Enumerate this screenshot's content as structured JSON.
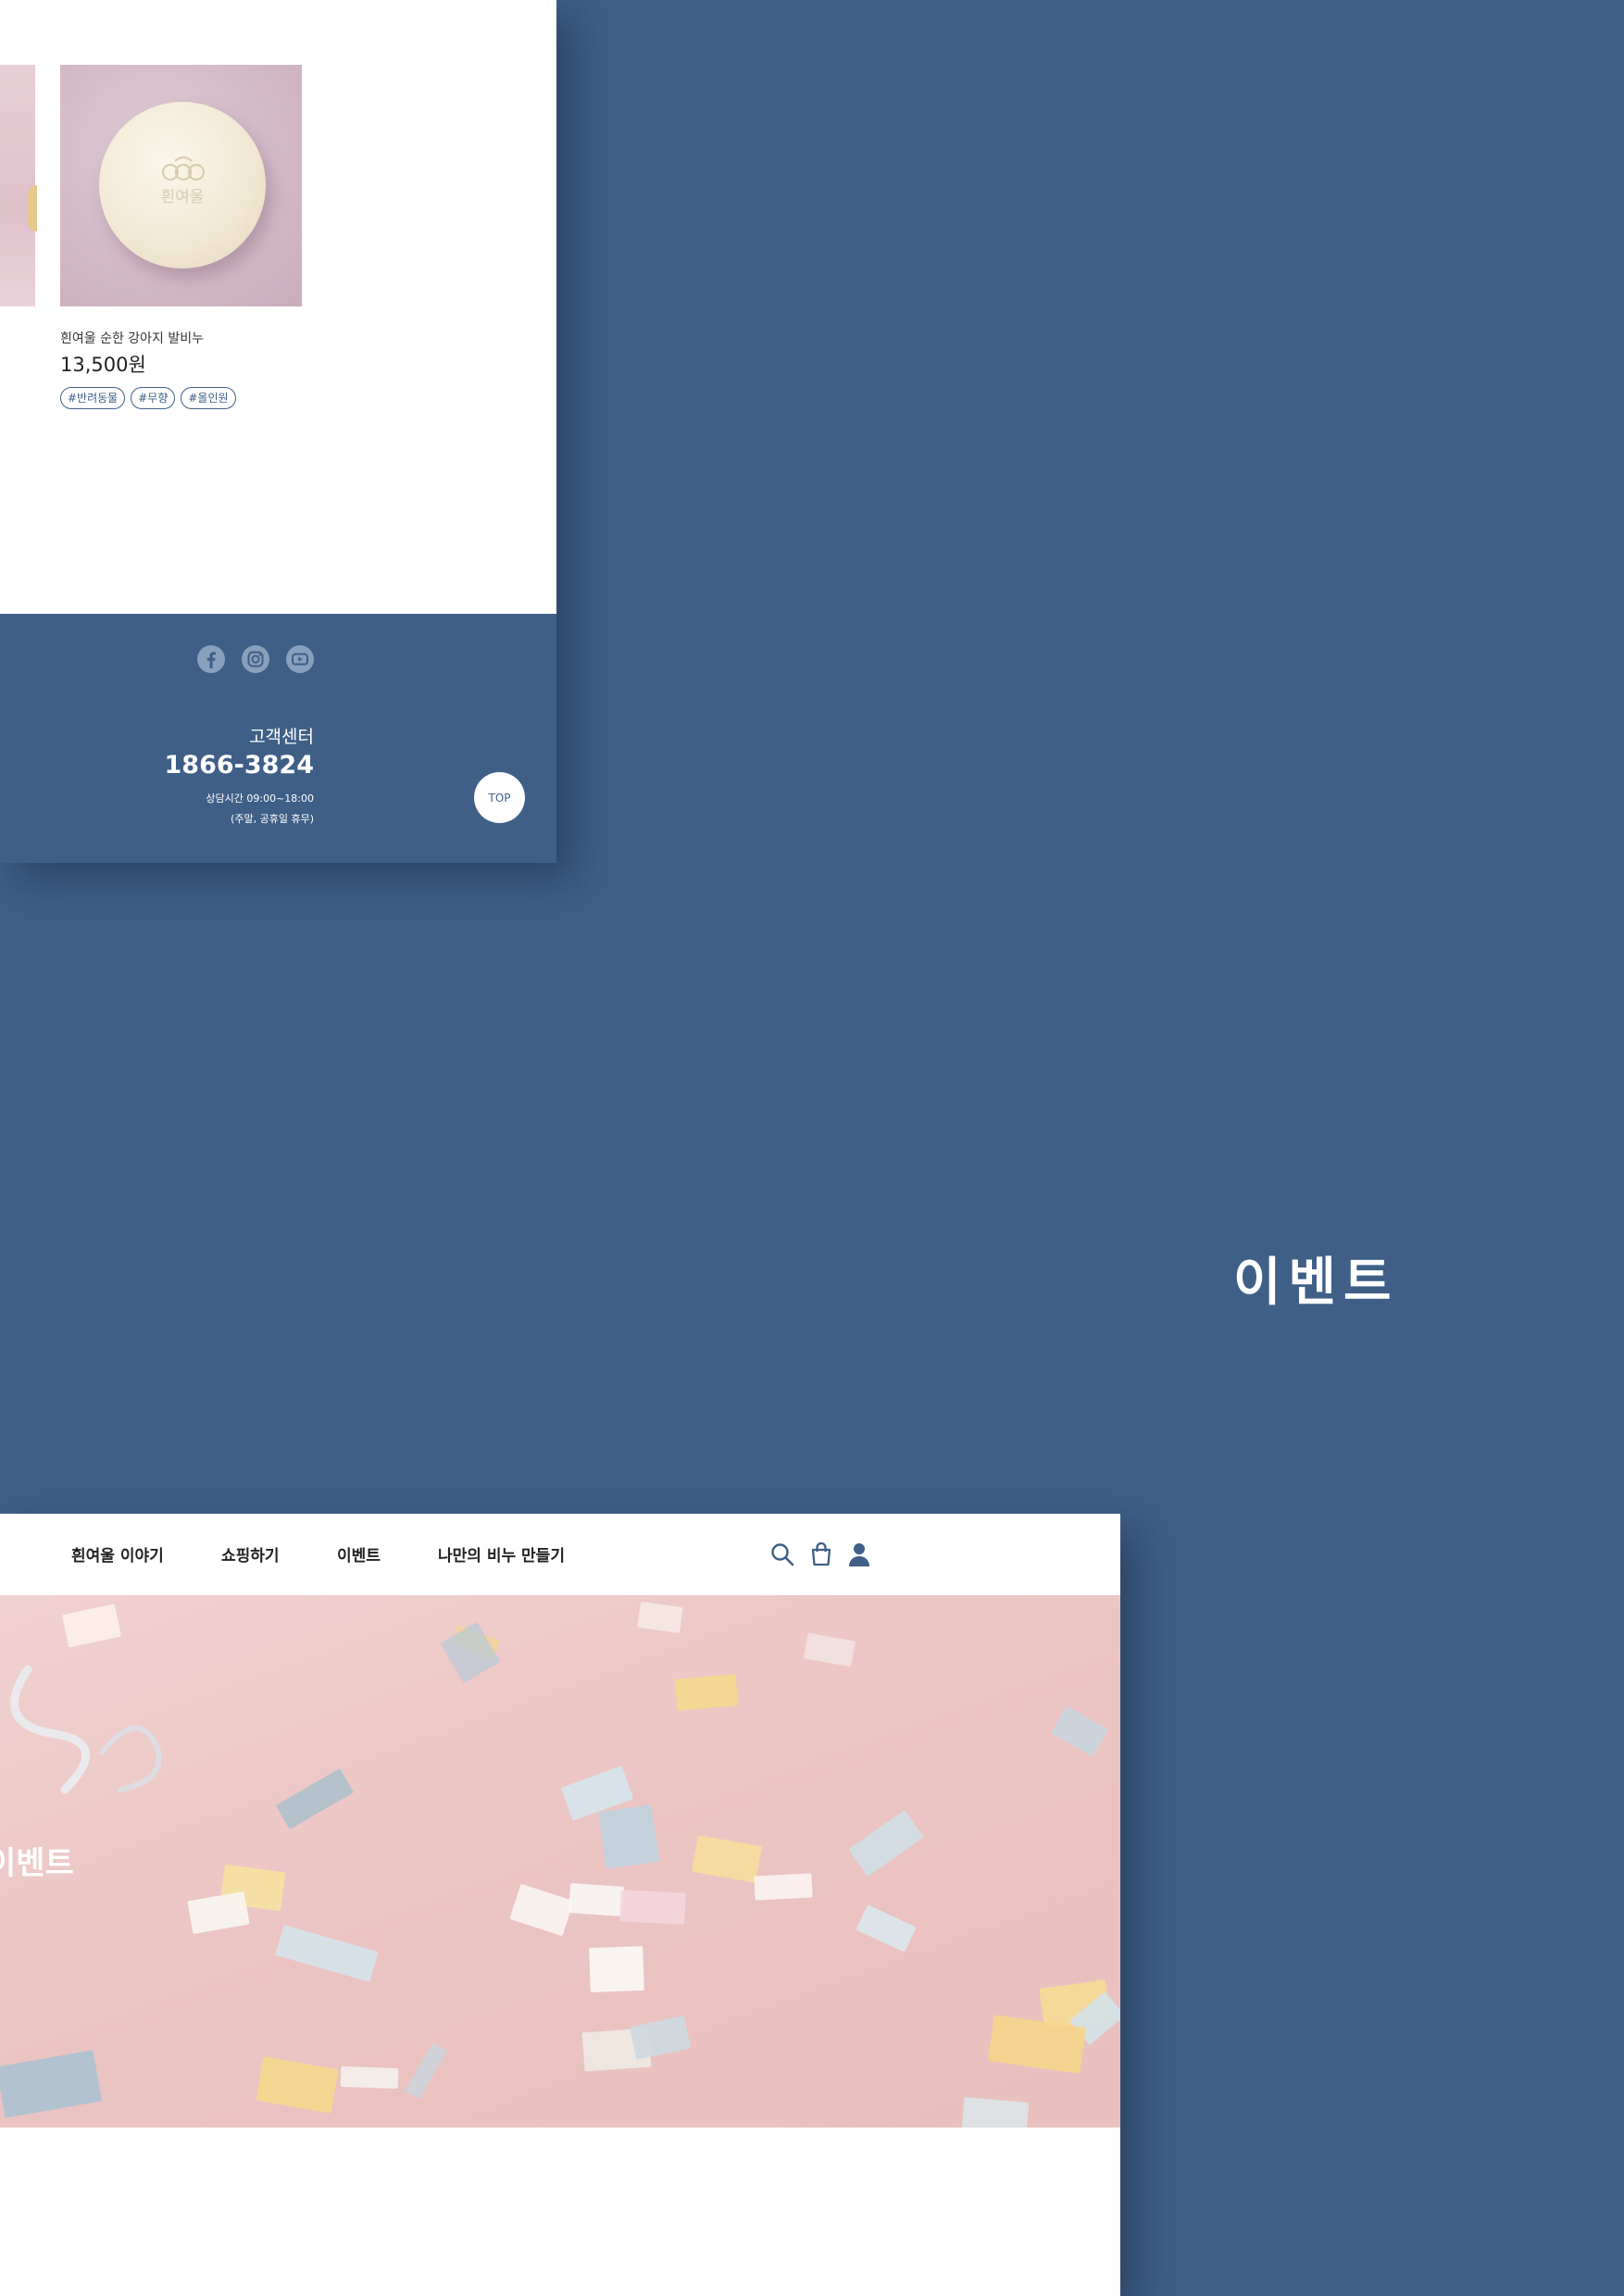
{
  "product": {
    "name": "흰여울 순한 강아지 발비누",
    "price": "13,500원",
    "tags": [
      "#반려동물",
      "#무향",
      "#올인원"
    ],
    "soap_stamp_text": "흰여울"
  },
  "footer": {
    "social": [
      "facebook-icon",
      "instagram-icon",
      "youtube-icon"
    ],
    "cs_label": "고객센터",
    "cs_phone": "1866-3824",
    "cs_hours": "상담시간 09:00~18:00",
    "cs_holiday": "(주말, 공휴일 휴무)",
    "top_label": "TOP"
  },
  "section_title": "이벤트",
  "nav": {
    "items": [
      "흰여울 이야기",
      "쇼핑하기",
      "이벤트",
      "나만의 비누 만들기"
    ],
    "icons": [
      "search-icon",
      "shopping-bag-icon",
      "user-icon"
    ]
  },
  "hero": {
    "title": "이벤트",
    "subtitle": "-"
  },
  "colors": {
    "brand": "#3f5f87",
    "white": "#ffffff",
    "hero_pink": "#ebc5c3"
  }
}
